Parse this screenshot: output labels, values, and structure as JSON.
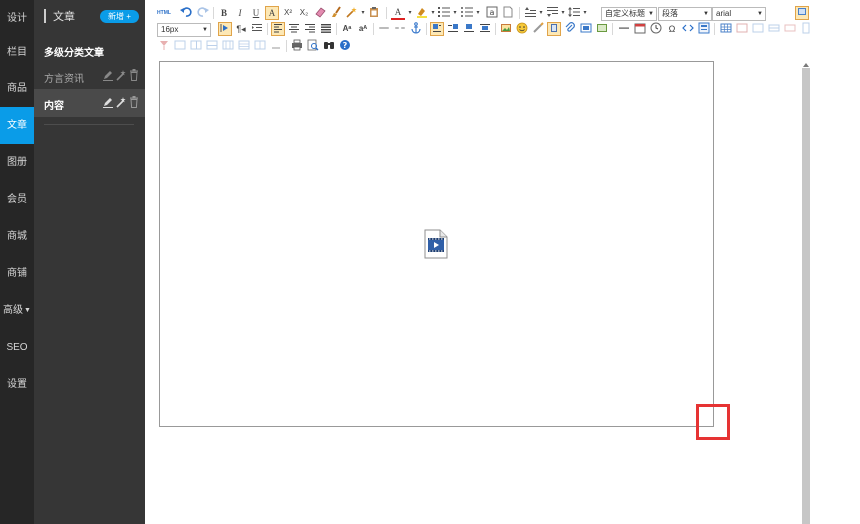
{
  "nav": {
    "items": [
      {
        "label": "设计",
        "active": false
      },
      {
        "label": "栏目",
        "active": false
      },
      {
        "label": "商品",
        "active": false
      },
      {
        "label": "文章",
        "active": true
      },
      {
        "label": "图册",
        "active": false
      },
      {
        "label": "会员",
        "active": false
      },
      {
        "label": "商城",
        "active": false
      },
      {
        "label": "商铺",
        "active": false
      },
      {
        "label": "高级",
        "active": false,
        "has_caret": true
      },
      {
        "label": "SEO",
        "active": false
      },
      {
        "label": "设置",
        "active": false
      }
    ],
    "active_color": "#0a9ce8"
  },
  "panel": {
    "title": "文章",
    "add_label": "新增 +",
    "group_title": "多级分类文章",
    "categories": [
      {
        "label": "方言资讯",
        "selected": false
      },
      {
        "label": "内容",
        "selected": true
      }
    ]
  },
  "toolbar": {
    "row1": [
      "html-icon",
      "undo-icon",
      "redo-icon",
      "bold-icon",
      "italic-icon",
      "underline-icon",
      "font-border-icon",
      "superscript-icon",
      "subscript-icon",
      "eraser-icon",
      "format-brush-icon",
      "auto-format-icon",
      "paste-text-icon",
      "font-color-icon",
      "highlight-color-icon",
      "ordered-list-icon",
      "unordered-list-icon",
      "select-all-icon",
      "clear-doc-icon",
      "row-spacing-top-icon",
      "row-spacing-bottom-icon",
      "line-height-icon"
    ],
    "row1_text": {
      "bold": "B",
      "italic": "I",
      "underline": "U",
      "font_border": "A",
      "superscript": "X²",
      "subscript": "X₂",
      "font_color": "A",
      "html": "HTML"
    },
    "heading_select": "自定义标题",
    "paragraph_select": "段落",
    "font_family_select": "arial",
    "font_size_select": "16px",
    "omega": "Ω"
  },
  "editor": {
    "content_icon": "video-file-icon",
    "handle_color": "#e63333"
  }
}
